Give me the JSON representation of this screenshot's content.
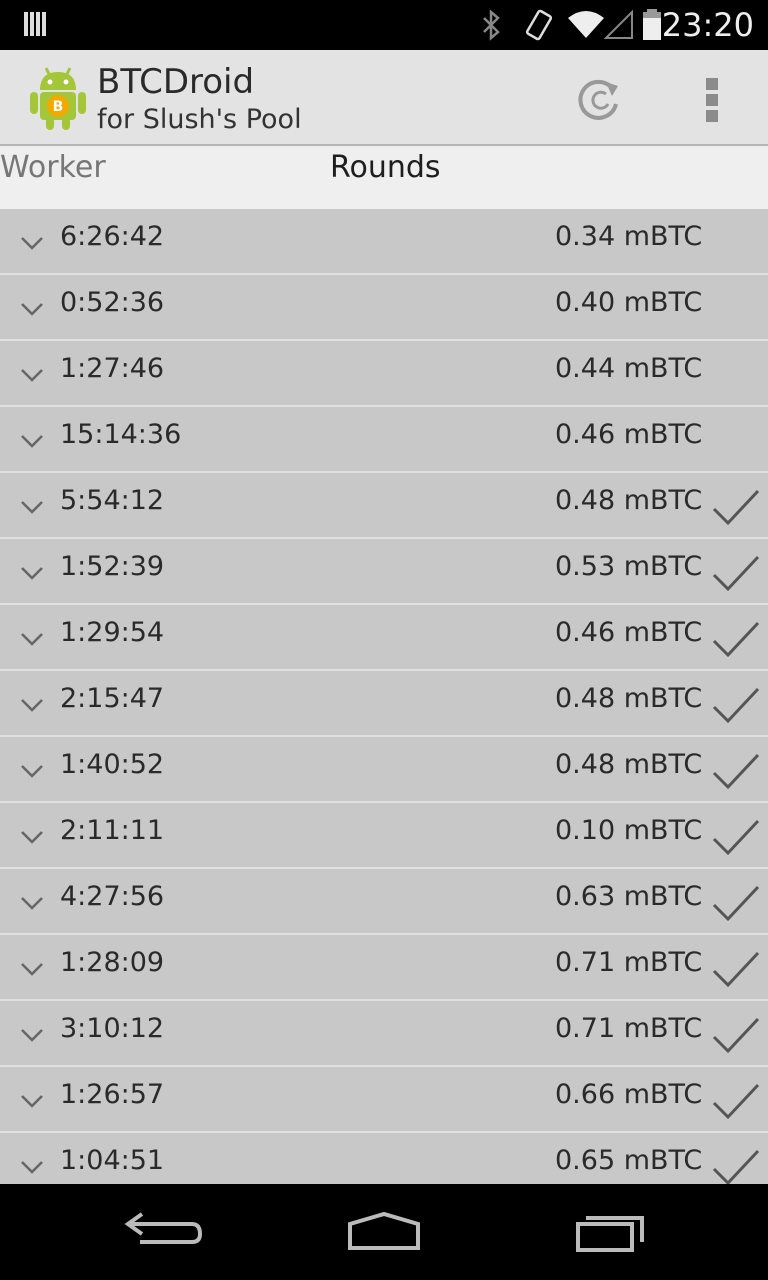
{
  "status_bar": {
    "time": "23:20",
    "icons": [
      "notification-icon",
      "bluetooth-icon",
      "vibrate-icon",
      "wifi-icon",
      "signal-icon",
      "battery-icon"
    ]
  },
  "action_bar": {
    "title": "BTCDroid",
    "subtitle": "for Slush's Pool",
    "icons": [
      "app-logo-icon",
      "refresh-icon",
      "overflow-menu-icon"
    ]
  },
  "tabs": [
    {
      "label": "Worker",
      "selected": false
    },
    {
      "label": "Rounds",
      "selected": true
    }
  ],
  "rounds": [
    {
      "duration": "6:26:42",
      "amount": "0.34 mBTC",
      "confirmed": false
    },
    {
      "duration": "0:52:36",
      "amount": "0.40 mBTC",
      "confirmed": false
    },
    {
      "duration": "1:27:46",
      "amount": "0.44 mBTC",
      "confirmed": false
    },
    {
      "duration": "15:14:36",
      "amount": "0.46 mBTC",
      "confirmed": false
    },
    {
      "duration": "5:54:12",
      "amount": "0.48 mBTC",
      "confirmed": true
    },
    {
      "duration": "1:52:39",
      "amount": "0.53 mBTC",
      "confirmed": true
    },
    {
      "duration": "1:29:54",
      "amount": "0.46 mBTC",
      "confirmed": true
    },
    {
      "duration": "2:15:47",
      "amount": "0.48 mBTC",
      "confirmed": true
    },
    {
      "duration": "1:40:52",
      "amount": "0.48 mBTC",
      "confirmed": true
    },
    {
      "duration": "2:11:11",
      "amount": "0.10 mBTC",
      "confirmed": true
    },
    {
      "duration": "4:27:56",
      "amount": "0.63 mBTC",
      "confirmed": true
    },
    {
      "duration": "1:28:09",
      "amount": "0.71 mBTC",
      "confirmed": true
    },
    {
      "duration": "3:10:12",
      "amount": "0.71 mBTC",
      "confirmed": true
    },
    {
      "duration": "1:26:57",
      "amount": "0.66 mBTC",
      "confirmed": true
    },
    {
      "duration": "1:04:51",
      "amount": "0.65 mBTC",
      "confirmed": true
    }
  ],
  "nav_bar": {
    "icons": [
      "back-icon",
      "home-icon",
      "recent-apps-icon"
    ]
  },
  "colors": {
    "list_background": "#c8c8c8",
    "action_bar_background": "#e3e3e3",
    "android_green": "#a4c639",
    "bitcoin_orange": "#f2a900"
  }
}
